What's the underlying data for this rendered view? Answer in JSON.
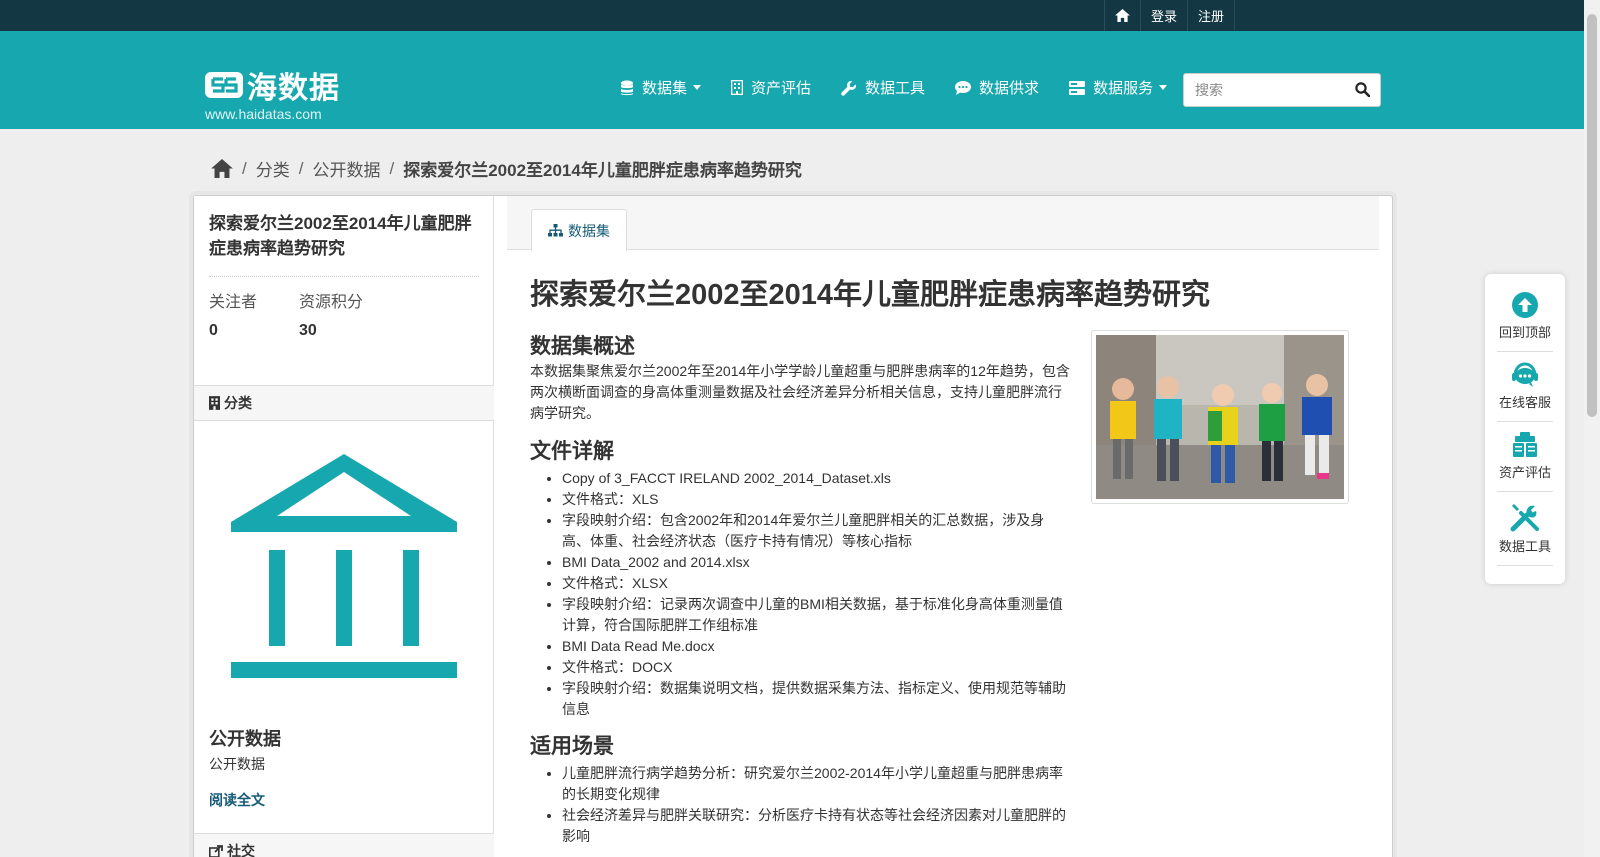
{
  "topbar": {
    "login": "登录",
    "register": "注册"
  },
  "brand": {
    "name": "海数据",
    "url": "www.haidatas.com"
  },
  "nav": {
    "items": [
      {
        "label": "数据集",
        "icon": "database-icon",
        "has_dropdown": true
      },
      {
        "label": "资产评估",
        "icon": "building-icon",
        "has_dropdown": false
      },
      {
        "label": "数据工具",
        "icon": "wrench-icon",
        "has_dropdown": false
      },
      {
        "label": "数据供求",
        "icon": "chat-icon",
        "has_dropdown": false
      },
      {
        "label": "数据服务",
        "icon": "server-icon",
        "has_dropdown": true
      }
    ]
  },
  "search": {
    "placeholder": "搜索",
    "value": ""
  },
  "breadcrumb": {
    "items": [
      "分类",
      "公开数据"
    ],
    "current": "探索爱尔兰2002至2014年儿童肥胖症患病率趋势研究"
  },
  "sidebar": {
    "title": "探索爱尔兰2002至2014年儿童肥胖症患病率趋势研究",
    "stats": [
      {
        "label": "关注者",
        "value": "0"
      },
      {
        "label": "资源积分",
        "value": "30"
      }
    ],
    "category_heading": "分类",
    "org_name": "公开数据",
    "org_desc": "公开数据",
    "read_more": "阅读全文",
    "social_heading": "社交"
  },
  "tab": {
    "label": "数据集"
  },
  "dataset": {
    "title": "探索爱尔兰2002至2014年儿童肥胖症患病率趋势研究",
    "overview_heading": "数据集概述",
    "overview": "本数据集聚焦爱尔兰2002年至2014年小学学龄儿童超重与肥胖患病率的12年趋势，包含两次横断面调查的身高体重测量数据及社会经济差异分析相关信息，支持儿童肥胖流行病学研究。",
    "files_heading": "文件详解",
    "files": [
      "Copy of 3_FACCT IRELAND 2002_2014_Dataset.xls",
      "文件格式：XLS",
      "字段映射介绍：包含2002年和2014年爱尔兰儿童肥胖相关的汇总数据，涉及身高、体重、社会经济状态（医疗卡持有情况）等核心指标",
      "BMI Data_2002 and 2014.xlsx",
      "文件格式：XLSX",
      "字段映射介绍：记录两次调查中儿童的BMI相关数据，基于标准化身高体重测量值计算，符合国际肥胖工作组标准",
      "BMI Data Read Me.docx",
      "文件格式：DOCX",
      "字段映射介绍：数据集说明文档，提供数据采集方法、指标定义、使用规范等辅助信息"
    ],
    "usage_heading": "适用场景",
    "usage": [
      "儿童肥胖流行病学趋势分析：研究爱尔兰2002-2014年小学儿童超重与肥胖患病率的长期变化规律",
      "社会经济差异与肥胖关联研究：分析医疗卡持有状态等社会经济因素对儿童肥胖的影响"
    ]
  },
  "float_bar": {
    "items": [
      {
        "label": "回到顶部",
        "icon": "arrow-up-icon"
      },
      {
        "label": "在线客服",
        "icon": "headset-icon"
      },
      {
        "label": "资产评估",
        "icon": "clipboard-icon"
      },
      {
        "label": "数据工具",
        "icon": "tools-icon"
      }
    ]
  },
  "colors": {
    "teal": "#17a7ae",
    "dark": "#143744",
    "link": "#165a77"
  }
}
